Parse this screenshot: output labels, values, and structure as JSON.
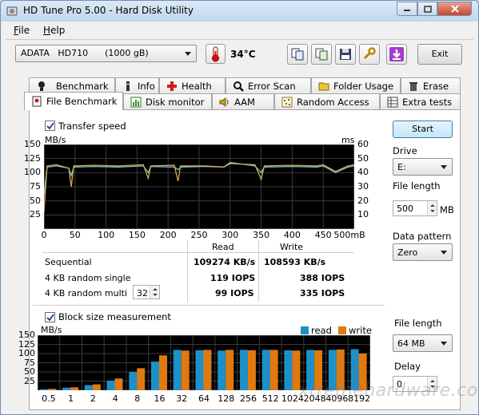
{
  "window": {
    "title": "HD Tune Pro 5.00 - Hard Disk Utility"
  },
  "menu": {
    "file": "File",
    "help": "Help"
  },
  "toolbar": {
    "drive": "ADATA   HD710      (1000 gB)",
    "temperature": "34°C",
    "exit": "Exit"
  },
  "tabs_top": [
    "Benchmark",
    "Info",
    "Health",
    "Error Scan",
    "Folder Usage",
    "Erase"
  ],
  "tabs_bottom": [
    "File Benchmark",
    "Disk monitor",
    "AAM",
    "Random Access",
    "Extra tests"
  ],
  "transfer": {
    "checkbox_label": "Transfer speed",
    "unit_left": "MB/s",
    "unit_right": "ms",
    "y_left": [
      "150",
      "125",
      "100",
      "75",
      "50",
      "25"
    ],
    "y_right": [
      "60",
      "50",
      "40",
      "30",
      "20",
      "10"
    ],
    "x_ticks": [
      "0",
      "50",
      "100",
      "150",
      "200",
      "250",
      "300",
      "350",
      "400",
      "450",
      "500mB"
    ]
  },
  "results": {
    "col_read": "Read",
    "col_write": "Write",
    "rows": [
      {
        "label": "Sequential",
        "read": "109274 KB/s",
        "write": "108593 KB/s"
      },
      {
        "label": "4 KB random single",
        "read": "119 IOPS",
        "write": "388 IOPS"
      },
      {
        "label": "4 KB random multi",
        "read": "99 IOPS",
        "write": "335 IOPS"
      }
    ],
    "multi_queue": "32"
  },
  "side": {
    "start": "Start",
    "drive_label": "Drive",
    "drive_value": "E:",
    "file_length_label": "File length",
    "file_length_value": "500",
    "file_length_unit": "MB",
    "pattern_label": "Data pattern",
    "pattern_value": "Zero",
    "file_length2_label": "File length",
    "file_length2_value": "64 MB",
    "delay_label": "Delay",
    "delay_value": "0"
  },
  "block": {
    "checkbox_label": "Block size measurement",
    "unit": "MB/s",
    "legend_read": "read",
    "legend_write": "write",
    "y_ticks": [
      "150",
      "125",
      "100",
      "75",
      "50",
      "25"
    ]
  },
  "watermark": "xtremehardware.com",
  "colors": {
    "read": "#1e90c8",
    "write": "#e07a10",
    "read_line": "#6fc4d6",
    "write_line": "#d8a64a"
  },
  "chart_data": [
    {
      "type": "line",
      "title": "Transfer speed",
      "xlabel": "mB",
      "ylabel": "MB/s",
      "xlim": [
        0,
        500
      ],
      "ylim": [
        0,
        150
      ],
      "series": [
        {
          "name": "read",
          "x": [
            0,
            5,
            20,
            40,
            44,
            48,
            80,
            120,
            160,
            168,
            172,
            210,
            216,
            220,
            260,
            290,
            300,
            340,
            350,
            355,
            400,
            440,
            450,
            470,
            490,
            500
          ],
          "values": [
            60,
            110,
            112,
            108,
            95,
            110,
            111,
            110,
            112,
            100,
            111,
            110,
            105,
            110,
            111,
            110,
            118,
            112,
            100,
            110,
            111,
            110,
            112,
            100,
            110,
            112
          ]
        },
        {
          "name": "write",
          "x": [
            0,
            5,
            20,
            40,
            44,
            48,
            80,
            120,
            160,
            168,
            172,
            210,
            216,
            220,
            260,
            290,
            300,
            340,
            350,
            355,
            400,
            440,
            450,
            470,
            490,
            500
          ],
          "values": [
            30,
            112,
            114,
            108,
            75,
            112,
            113,
            112,
            114,
            90,
            112,
            113,
            85,
            112,
            112,
            110,
            116,
            114,
            88,
            112,
            113,
            112,
            114,
            102,
            112,
            114
          ]
        }
      ]
    },
    {
      "type": "bar",
      "title": "Block size measurement",
      "ylabel": "MB/s",
      "ylim": [
        0,
        150
      ],
      "categories": [
        "0.5",
        "1",
        "2",
        "4",
        "8",
        "16",
        "32",
        "64",
        "128",
        "256",
        "512",
        "1024",
        "2048",
        "4096",
        "8192"
      ],
      "series": [
        {
          "name": "read",
          "values": [
            3,
            7,
            14,
            26,
            50,
            78,
            110,
            109,
            108,
            110,
            110,
            109,
            110,
            110,
            112
          ]
        },
        {
          "name": "write",
          "values": [
            4,
            8,
            16,
            32,
            60,
            95,
            108,
            110,
            110,
            109,
            110,
            108,
            109,
            111,
            100
          ]
        }
      ]
    }
  ]
}
